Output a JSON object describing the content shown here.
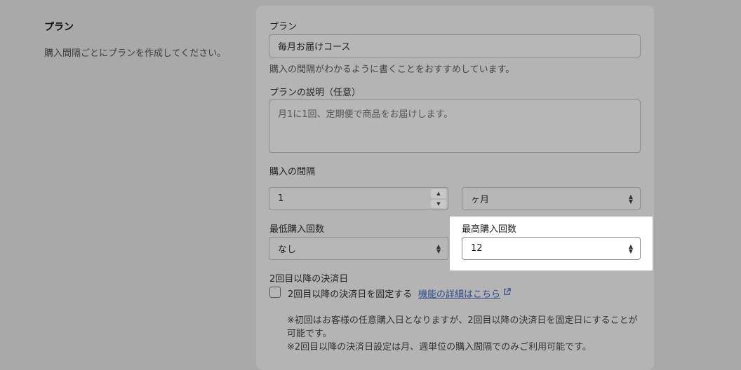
{
  "section": {
    "title": "プラン",
    "description": "購入間隔ごとにプランを作成してください。"
  },
  "plan": {
    "label": "プラン",
    "value": "毎月お届けコース",
    "hint": "購入の間隔がわかるように書くことをおすすめしています。"
  },
  "description": {
    "label": "プランの説明（任意）",
    "value": "月1に1回、定期便で商品をお届けします。"
  },
  "interval": {
    "label": "購入の間隔",
    "value": "1",
    "unit": "ヶ月"
  },
  "min_purchases": {
    "label": "最低購入回数",
    "value": "なし"
  },
  "max_purchases": {
    "label": "最高購入回数",
    "value": "12"
  },
  "payment_date": {
    "label": "2回目以降の決済日",
    "checkbox_label": "2回目以降の決済日を固定する",
    "link_text": "機能の詳細はこちら",
    "note_line1": "※初回はお客様の任意購入日となりますが、2回目以降の決済日を固定日にすることが",
    "note_line2": "可能です。",
    "note_line3": "※2回目以降の決済日設定は月、週単位の購入間隔でのみご利用可能です。"
  }
}
